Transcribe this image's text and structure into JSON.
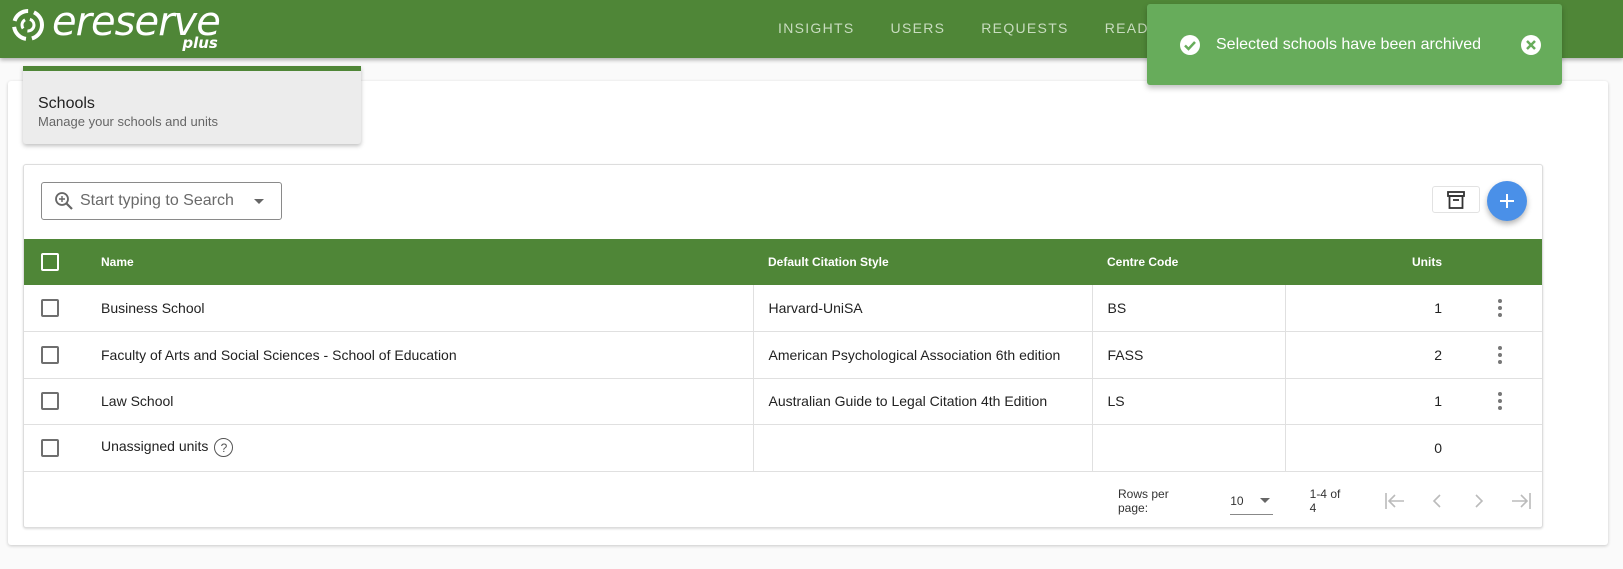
{
  "app": {
    "logo_text": "ereserve",
    "logo_sub": "plus",
    "brand_color": "#4f8637",
    "accent_color": "#4a90e8"
  },
  "nav": {
    "items": [
      {
        "label": "INSIGHTS"
      },
      {
        "label": "USERS"
      },
      {
        "label": "REQUESTS"
      },
      {
        "label": "READINGS"
      }
    ]
  },
  "toast": {
    "message": "Selected schools have been archived",
    "icon": "check-circle-icon",
    "close_icon": "close-circle-icon",
    "color": "#67ac5b"
  },
  "header": {
    "title": "Schools",
    "subtitle": "Manage your schools and units"
  },
  "search": {
    "placeholder": "Start typing to Search"
  },
  "table": {
    "columns": [
      "Name",
      "Default Citation Style",
      "Centre Code",
      "Units"
    ],
    "rows": [
      {
        "name": "Business School",
        "citation": "Harvard-UniSA",
        "code": "BS",
        "units": "1"
      },
      {
        "name": "Faculty of Arts and Social Sciences - School of Education",
        "citation": "American Psychological Association 6th edition",
        "code": "FASS",
        "units": "2"
      },
      {
        "name": "Law School",
        "citation": "Australian Guide to Legal Citation 4th Edition",
        "code": "LS",
        "units": "1"
      },
      {
        "name": "Unassigned units",
        "citation": "",
        "code": "",
        "units": "0"
      }
    ]
  },
  "pagination": {
    "rows_per_page_label": "Rows per page:",
    "rows_per_page": "10",
    "range": "1-4 of 4"
  }
}
